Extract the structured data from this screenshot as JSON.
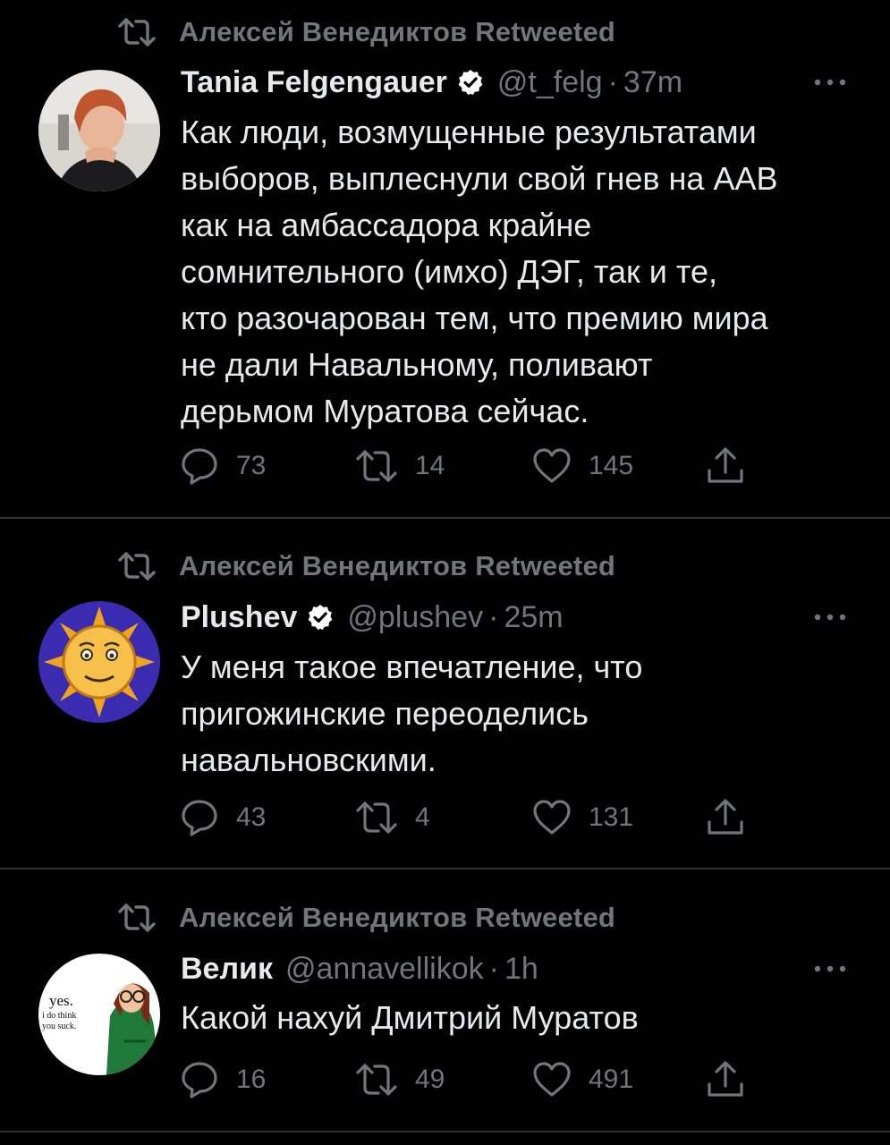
{
  "tweets": [
    {
      "retweeted_by": "Алексей Венедиктов Retweeted",
      "name": "Tania Felgengauer",
      "verified": true,
      "handle": "@t_felg",
      "separator": "·",
      "time": "37m",
      "text_lines": [
        "Как люди, возмущенные результатами",
        "выборов, выплеснули свой гнев на ААВ",
        "как на амбассадора крайне",
        "сомнительного (имхо) ДЭГ, так и те,",
        "кто разочарован тем, что премию мира",
        "не дали Навальному, поливают",
        "дерьмом Муратова сейчас."
      ],
      "replies": "73",
      "retweets": "14",
      "likes": "145"
    },
    {
      "retweeted_by": "Алексей Венедиктов Retweeted",
      "name": "Plushev",
      "verified": true,
      "handle": "@plushev",
      "separator": "·",
      "time": "25m",
      "text_lines": [
        "У меня такое впечатление, что",
        "пригожинские переоделись",
        "навальновскими."
      ],
      "replies": "43",
      "retweets": "4",
      "likes": "131"
    },
    {
      "retweeted_by": "Алексей Венедиктов Retweeted",
      "name": "Велик",
      "verified": false,
      "handle": "@annavellikok",
      "separator": "·",
      "time": "1h",
      "text_lines": [
        "Какой нахуй Дмитрий Муратов"
      ],
      "replies": "16",
      "retweets": "49",
      "likes": "491",
      "avatar_text": [
        "yes.",
        "i do think",
        "you suck."
      ]
    }
  ],
  "colors": {
    "background": "#000000",
    "text": "#e7e9ea",
    "secondary": "#71767b",
    "divider": "#2f3336",
    "verified_badge": "#ffffff"
  },
  "icons": {
    "retweet_header": "retweet-icon",
    "verified": "verified-badge-icon",
    "more": "more-icon",
    "reply": "reply-icon",
    "retweet": "retweet-icon",
    "like": "like-icon",
    "share": "share-icon"
  }
}
